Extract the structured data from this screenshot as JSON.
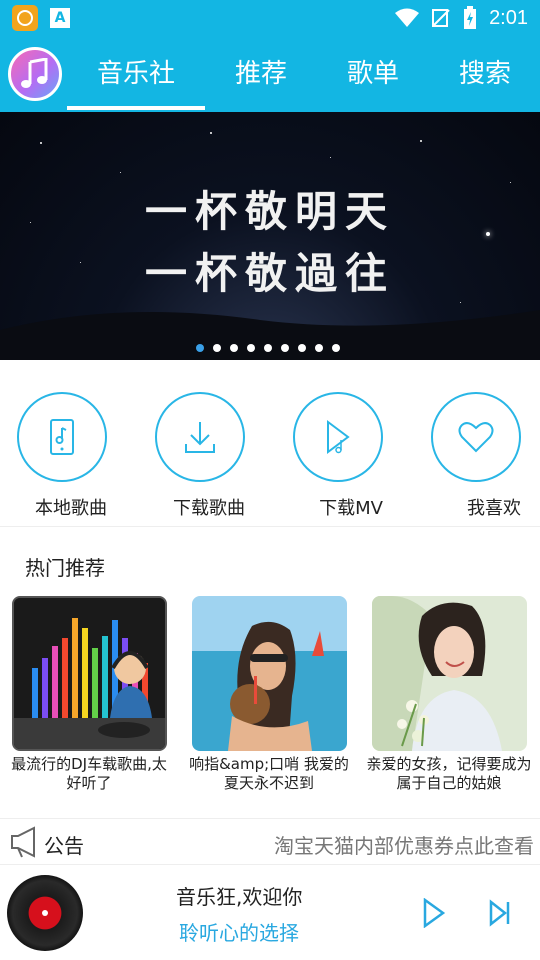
{
  "status_bar": {
    "time": "2:01",
    "badge_letter": "A"
  },
  "tabs": [
    {
      "label": "音乐社",
      "active": true
    },
    {
      "label": "推荐",
      "active": false
    },
    {
      "label": "歌单",
      "active": false
    },
    {
      "label": "搜索",
      "active": false
    }
  ],
  "banner": {
    "line1": "一杯敬明天",
    "line2": "一杯敬過往",
    "slide_count": 9,
    "active_slide": 0
  },
  "quick_actions": [
    {
      "label": "本地歌曲",
      "icon": "phone-music-icon"
    },
    {
      "label": "下载歌曲",
      "icon": "download-icon"
    },
    {
      "label": "下载MV",
      "icon": "video-file-icon"
    },
    {
      "label": "我喜欢",
      "icon": "heart-icon"
    }
  ],
  "hot": {
    "title": "热门推荐",
    "items": [
      {
        "title": "最流行的DJ车载歌曲,太好听了",
        "image": "dj-equalizer-image"
      },
      {
        "title": "响指&amp;口哨 我爱的夏天永不迟到",
        "image": "beach-coconut-image"
      },
      {
        "title": "亲爱的女孩，记得要成为属于自己的姑娘",
        "image": "girl-flowers-image"
      }
    ]
  },
  "notice": {
    "label": "公告",
    "text": "淘宝天猫内部优惠券点此查看"
  },
  "player": {
    "song": "音乐狂,欢迎你",
    "subtitle": "聆听心的选择"
  },
  "colors": {
    "accent": "#13b6e3",
    "link": "#29a8e0"
  }
}
